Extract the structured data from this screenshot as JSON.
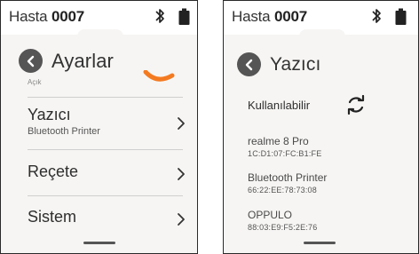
{
  "left_screen": {
    "patient_label": "Hasta",
    "patient_number": "0007",
    "title": "Ayarlar",
    "partial_item_label": "Açık",
    "menu": [
      {
        "label": "Yazıcı",
        "sublabel": "Bluetooth Printer"
      },
      {
        "label": "Reçete",
        "sublabel": ""
      },
      {
        "label": "Sistem",
        "sublabel": ""
      }
    ]
  },
  "right_screen": {
    "patient_label": "Hasta",
    "patient_number": "0007",
    "title": "Yazıcı",
    "available_label": "Kullanılabilir",
    "devices": [
      {
        "name": "realme 8 Pro",
        "mac": "1C:D1:07:FC:B1:FE"
      },
      {
        "name": "Bluetooth Printer",
        "mac": "66:22:EE:78:73:08"
      },
      {
        "name": "OPPULO",
        "mac": "88:03:E9:F5:2E:76"
      }
    ]
  },
  "colors": {
    "accent_orange": "#f47a20",
    "back_button": "#555555",
    "background": "#f6f5f3",
    "frame": "#2a2a2a"
  },
  "icons": [
    "bluetooth-icon",
    "battery-icon",
    "back-arrow-icon",
    "chevron-right-icon",
    "refresh-icon"
  ]
}
